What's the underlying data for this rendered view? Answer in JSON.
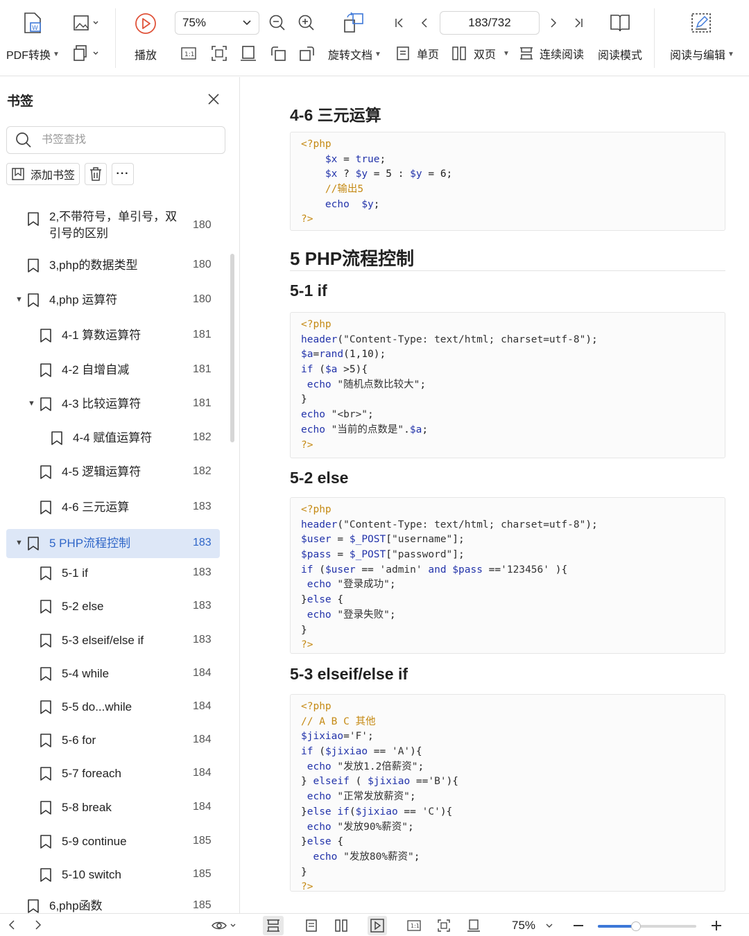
{
  "toolbar": {
    "pdf_convert": "PDF转换",
    "play": "播放",
    "zoom": "75%",
    "rotate": "旋转文档",
    "page_indicator": "183/732",
    "single_page": "单页",
    "double_page": "双页",
    "continuous": "连续阅读",
    "reading_mode": "阅读模式",
    "read_edit": "阅读与编辑",
    "actual_size": "1:1"
  },
  "sidebar": {
    "title": "书签",
    "search_placeholder": "书签查找",
    "add_bookmark": "添加书签",
    "more": "···",
    "items": [
      {
        "label": "2,不带符号，单引号，双",
        "label2": "引号的区别",
        "page": "180",
        "level": 0
      },
      {
        "label": "3,php的数据类型",
        "page": "180",
        "level": 0
      },
      {
        "label": "4,php 运算符",
        "page": "180",
        "level": 0,
        "expanded": true
      },
      {
        "label": "4-1 算数运算符",
        "page": "181",
        "level": 1
      },
      {
        "label": "4-2 自增自减",
        "page": "181",
        "level": 1
      },
      {
        "label": "4-3 比较运算符",
        "page": "181",
        "level": 1,
        "expanded": true
      },
      {
        "label": "4-4 赋值运算符",
        "page": "182",
        "level": 2
      },
      {
        "label": "4-5 逻辑运算符",
        "page": "182",
        "level": 1
      },
      {
        "label": "4-6 三元运算",
        "page": "183",
        "level": 1
      },
      {
        "label": "5 PHP流程控制",
        "page": "183",
        "level": 0,
        "expanded": true,
        "active": true
      },
      {
        "label": "5-1 if",
        "page": "183",
        "level": 1
      },
      {
        "label": "5-2 else",
        "page": "183",
        "level": 1
      },
      {
        "label": "5-3 elseif/else if",
        "page": "183",
        "level": 1
      },
      {
        "label": "5-4 while",
        "page": "184",
        "level": 1
      },
      {
        "label": "5-5 do...while",
        "page": "184",
        "level": 1
      },
      {
        "label": "5-6 for",
        "page": "184",
        "level": 1
      },
      {
        "label": "5-7 foreach",
        "page": "184",
        "level": 1
      },
      {
        "label": "5-8 break",
        "page": "184",
        "level": 1
      },
      {
        "label": "5-9 continue",
        "page": "185",
        "level": 1
      },
      {
        "label": "5-10 switch",
        "page": "185",
        "level": 1
      },
      {
        "label": "6,php函数",
        "page": "185",
        "level": 0
      }
    ]
  },
  "document": {
    "heading_46": "4-6 三元运算",
    "heading_5": "5 PHP流程控制",
    "heading_51": "5-1 if",
    "heading_52": "5-2 else",
    "heading_53": "5-3 elseif/else if",
    "code_46": [
      "<?php",
      "    $x = true;",
      "    $x ? $y = 5 : $y = 6;",
      "    //输出5",
      "    echo  $y;",
      "?>"
    ],
    "code_51": [
      "<?php",
      "header(\"Content-Type: text/html; charset=utf-8\");",
      "$a=rand(1,10);",
      "if ($a >5){",
      " echo \"随机点数比较大\";",
      "}",
      "echo \"<br>\";",
      "echo \"当前的点数是\".$a;",
      "?>"
    ],
    "code_52": [
      "<?php",
      "header(\"Content-Type: text/html; charset=utf-8\");",
      "$user = $_POST[\"username\"];",
      "$pass = $_POST[\"password\"];",
      "if ($user == 'admin' and $pass =='123456' ){",
      " echo \"登录成功\";",
      "}else {",
      " echo \"登录失败\";",
      "}",
      "?>"
    ],
    "code_53": [
      "<?php",
      "// A B C 其他",
      "$jixiao='F';",
      "if ($jixiao == 'A'){",
      " echo \"发放1.2倍薪资\";",
      "} elseif ( $jixiao =='B'){",
      " echo \"正常发放薪资\";",
      "}else if($jixiao == 'C'){",
      " echo \"发放90%薪资\";",
      "}else {",
      "  echo \"发放80%薪资\";",
      "}",
      "?>"
    ]
  },
  "statusbar": {
    "zoom": "75%",
    "zoom_fraction": 0.39
  }
}
